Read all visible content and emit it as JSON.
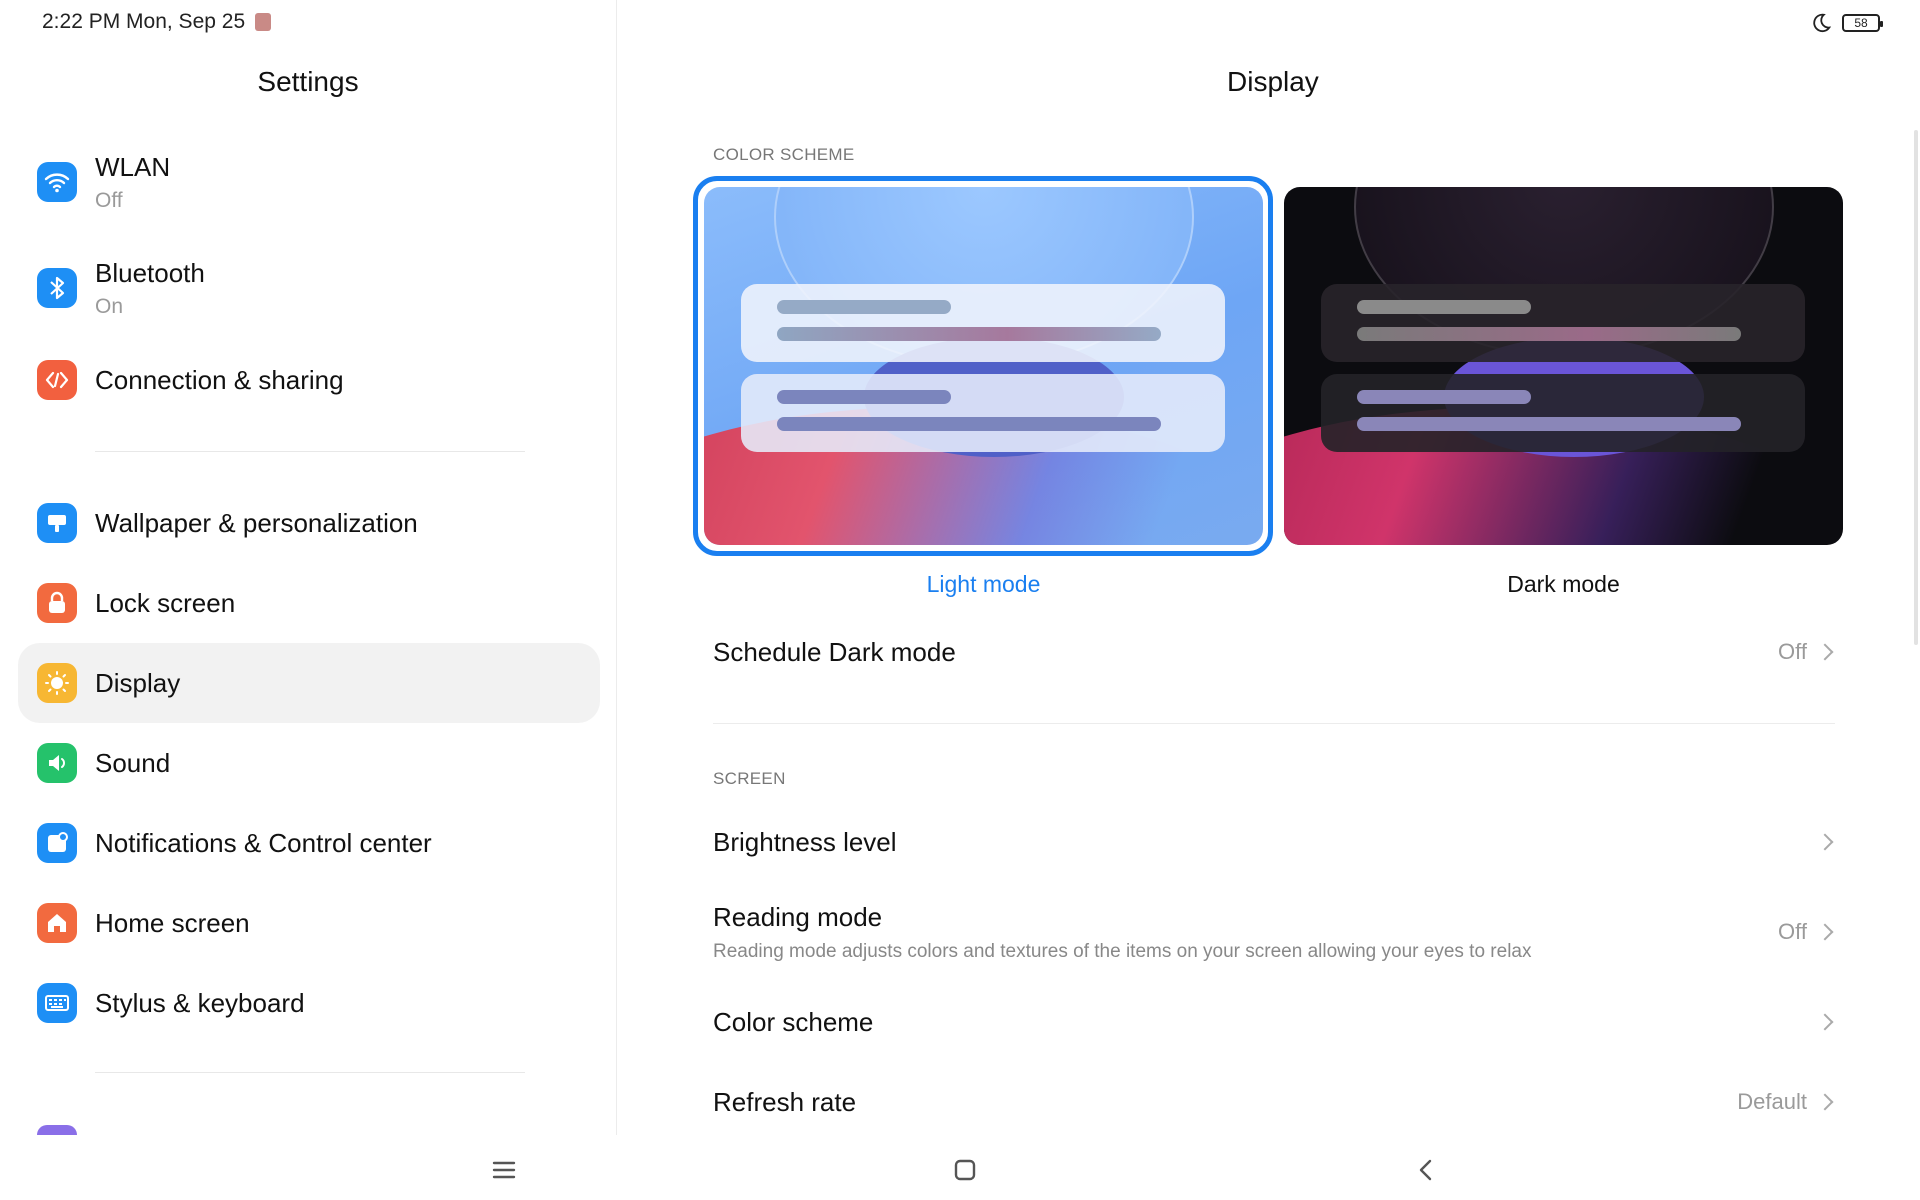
{
  "status_bar": {
    "time": "2:22 PM Mon, Sep 25",
    "battery": "58"
  },
  "left_panel": {
    "title": "Settings",
    "items": [
      {
        "label": "WLAN",
        "sublabel": "Off",
        "icon": "wifi-icon",
        "color": "#1e8ff5"
      },
      {
        "label": "Bluetooth",
        "sublabel": "On",
        "icon": "bluetooth-icon",
        "color": "#1e8ff5"
      },
      {
        "label": "Connection & sharing",
        "icon": "connection-icon",
        "color": "#f2603f"
      },
      {
        "label": "Wallpaper & personalization",
        "icon": "wallpaper-icon",
        "color": "#1e8ff5"
      },
      {
        "label": "Lock screen",
        "icon": "lock-icon",
        "color": "#f26a3f"
      },
      {
        "label": "Display",
        "icon": "sun-icon",
        "color": "#f7b733",
        "active": true
      },
      {
        "label": "Sound",
        "icon": "speaker-icon",
        "color": "#25c26b"
      },
      {
        "label": "Notifications & Control center",
        "icon": "notifications-icon",
        "color": "#1e8ff5"
      },
      {
        "label": "Home screen",
        "icon": "home-icon",
        "color": "#f26a3f"
      },
      {
        "label": "Stylus & keyboard",
        "icon": "keyboard-icon",
        "color": "#1e8ff5"
      }
    ]
  },
  "main": {
    "title": "Display",
    "color_scheme_section": "COLOR SCHEME",
    "light_mode_label": "Light mode",
    "dark_mode_label": "Dark mode",
    "selected_scheme": "light",
    "schedule": {
      "title": "Schedule Dark mode",
      "value": "Off"
    },
    "screen_section": "SCREEN",
    "brightness": {
      "title": "Brightness level"
    },
    "reading": {
      "title": "Reading mode",
      "description": "Reading mode adjusts colors and textures of the items on your screen allowing your eyes to relax",
      "value": "Off"
    },
    "color_scheme": {
      "title": "Color scheme"
    },
    "refresh_rate": {
      "title": "Refresh rate",
      "value": "Default"
    }
  },
  "colors": {
    "accent": "#1a7ff0",
    "active_bg": "#f2f2f2"
  }
}
